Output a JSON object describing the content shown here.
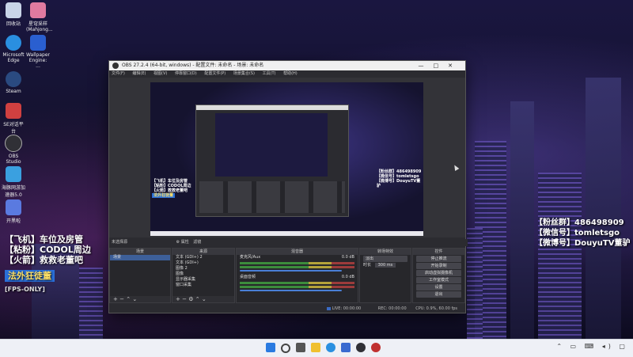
{
  "desktop": {
    "icons": [
      {
        "label": "回收站",
        "color": "#c8d4e8"
      },
      {
        "label": "星穹采样 (Mahjong...",
        "color": "#e07aa0"
      },
      {
        "label": "Microsoft Edge",
        "color": "#2a8fe0"
      },
      {
        "label": "Wallpaper Engine: ...",
        "color": "#2a5fd0"
      },
      {
        "label": "Steam",
        "color": "#2a4a80"
      },
      {
        "label": "SE对话平台",
        "color": "#d04040"
      },
      {
        "label": "OBS Studio",
        "color": "#303036"
      },
      {
        "label": "海豚网游加速器5.0",
        "color": "#3aa0e0"
      },
      {
        "label": "开黑啦",
        "color": "#5a7ae0"
      }
    ]
  },
  "overlay_left": {
    "lines": [
      "【飞机】车位及房管",
      "【粘粉】CODOL周边",
      "【火箭】救救老董吧"
    ],
    "game": "法外狂徒董",
    "fps": "[FPS-ONLY]"
  },
  "overlay_right": {
    "lines": [
      "【粉丝群】486498909",
      "【微信号】tomletsgo",
      "【微博号】DouyuTV董驴"
    ]
  },
  "obs": {
    "title": "OBS 27.2.4 (64-bit, windows) - 配置文件: 未命名 - 场景: 未命名",
    "menu": [
      "文件(F)",
      "编辑(E)",
      "视图(V)",
      "停靠窗口(D)",
      "配置文件(P)",
      "场景集合(S)",
      "工具(T)",
      "帮助(H)"
    ],
    "preview_texts": {
      "left": [
        "【飞机】车位及房管",
        "【粘粉】CODOL周边",
        "【火箭】救救老董吧"
      ],
      "game": "法外狂徒董",
      "right": [
        "【粉丝群】486498909",
        "【微信号】tomletsgo",
        "【微博号】DouyuTV董驴"
      ]
    },
    "scene_label": "未选择源",
    "scene_buttons": [
      "属性",
      "滤镜"
    ],
    "docks": {
      "scenes": {
        "title": "场景",
        "items": [
          "场景"
        ]
      },
      "sources": {
        "title": "来源",
        "items": [
          "文本 (GDI+) 2",
          "文本 (GDI+)",
          "图像 2",
          "图像",
          "显示器采集",
          "窗口采集"
        ]
      },
      "mixer": {
        "title": "混音器",
        "tracks": [
          {
            "name": "麦克风/Aux",
            "db": "0.0 dB"
          },
          {
            "name": "桌面音频",
            "db": "0.0 dB"
          }
        ]
      },
      "transitions": {
        "title": "转场特效",
        "type": "淡出",
        "duration_label": "时长",
        "duration": "300 ms"
      },
      "controls": {
        "title": "控件",
        "buttons": [
          "停止推流",
          "开始录制",
          "启动虚拟摄像机",
          "工作室模式",
          "设置",
          "退出"
        ]
      }
    },
    "status": {
      "live": "LIVE: 00:00:00",
      "rec": "REC: 00:00:00",
      "cpu": "CPU: 0.9%, 60.00 fps"
    }
  },
  "colors": {
    "accent": "#3d5f99",
    "obs_bg": "#2b2b30",
    "taskbar": "#eef0f6"
  }
}
